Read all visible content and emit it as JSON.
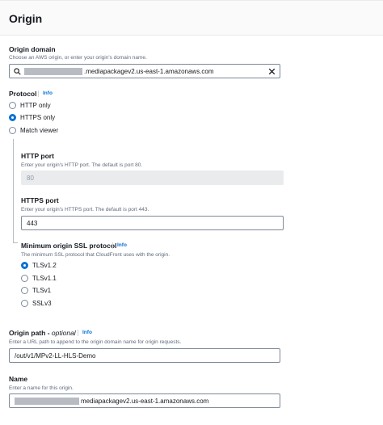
{
  "header": {
    "title": "Origin"
  },
  "origin_domain": {
    "label": "Origin domain",
    "description": "Choose an AWS origin, or enter your origin's domain name.",
    "value_suffix": ".mediapackagev2.us-east-1.amazonaws.com"
  },
  "protocol": {
    "label": "Protocol",
    "info": "Info",
    "options": [
      "HTTP only",
      "HTTPS only",
      "Match viewer"
    ],
    "selected": "HTTPS only"
  },
  "http_port": {
    "label": "HTTP port",
    "description": "Enter your origin's HTTP port. The default is port 80.",
    "value": "80"
  },
  "https_port": {
    "label": "HTTPS port",
    "description": "Enter your origin's HTTPS port. The default is port 443.",
    "value": "443"
  },
  "ssl": {
    "label": "Minimum origin SSL protocol",
    "info": "Info",
    "description": "The minimum SSL protocol that CloudFront uses with the origin.",
    "options": [
      "TLSv1.2",
      "TLSv1.1",
      "TLSv1",
      "SSLv3"
    ],
    "selected": "TLSv1.2"
  },
  "origin_path": {
    "label": "Origin path",
    "optional": "optional",
    "info": "Info",
    "description": "Enter a URL path to append to the origin domain name for origin requests.",
    "value": "/out/v1/MPv2-LL-HLS-Demo"
  },
  "name": {
    "label": "Name",
    "description": "Enter a name for this origin.",
    "value_suffix": "mediapackagev2.us-east-1.amazonaws.com"
  },
  "colors": {
    "accent": "#0972d3",
    "text": "#16191f",
    "muted": "#5f6b7a",
    "border": "#7d8998"
  }
}
